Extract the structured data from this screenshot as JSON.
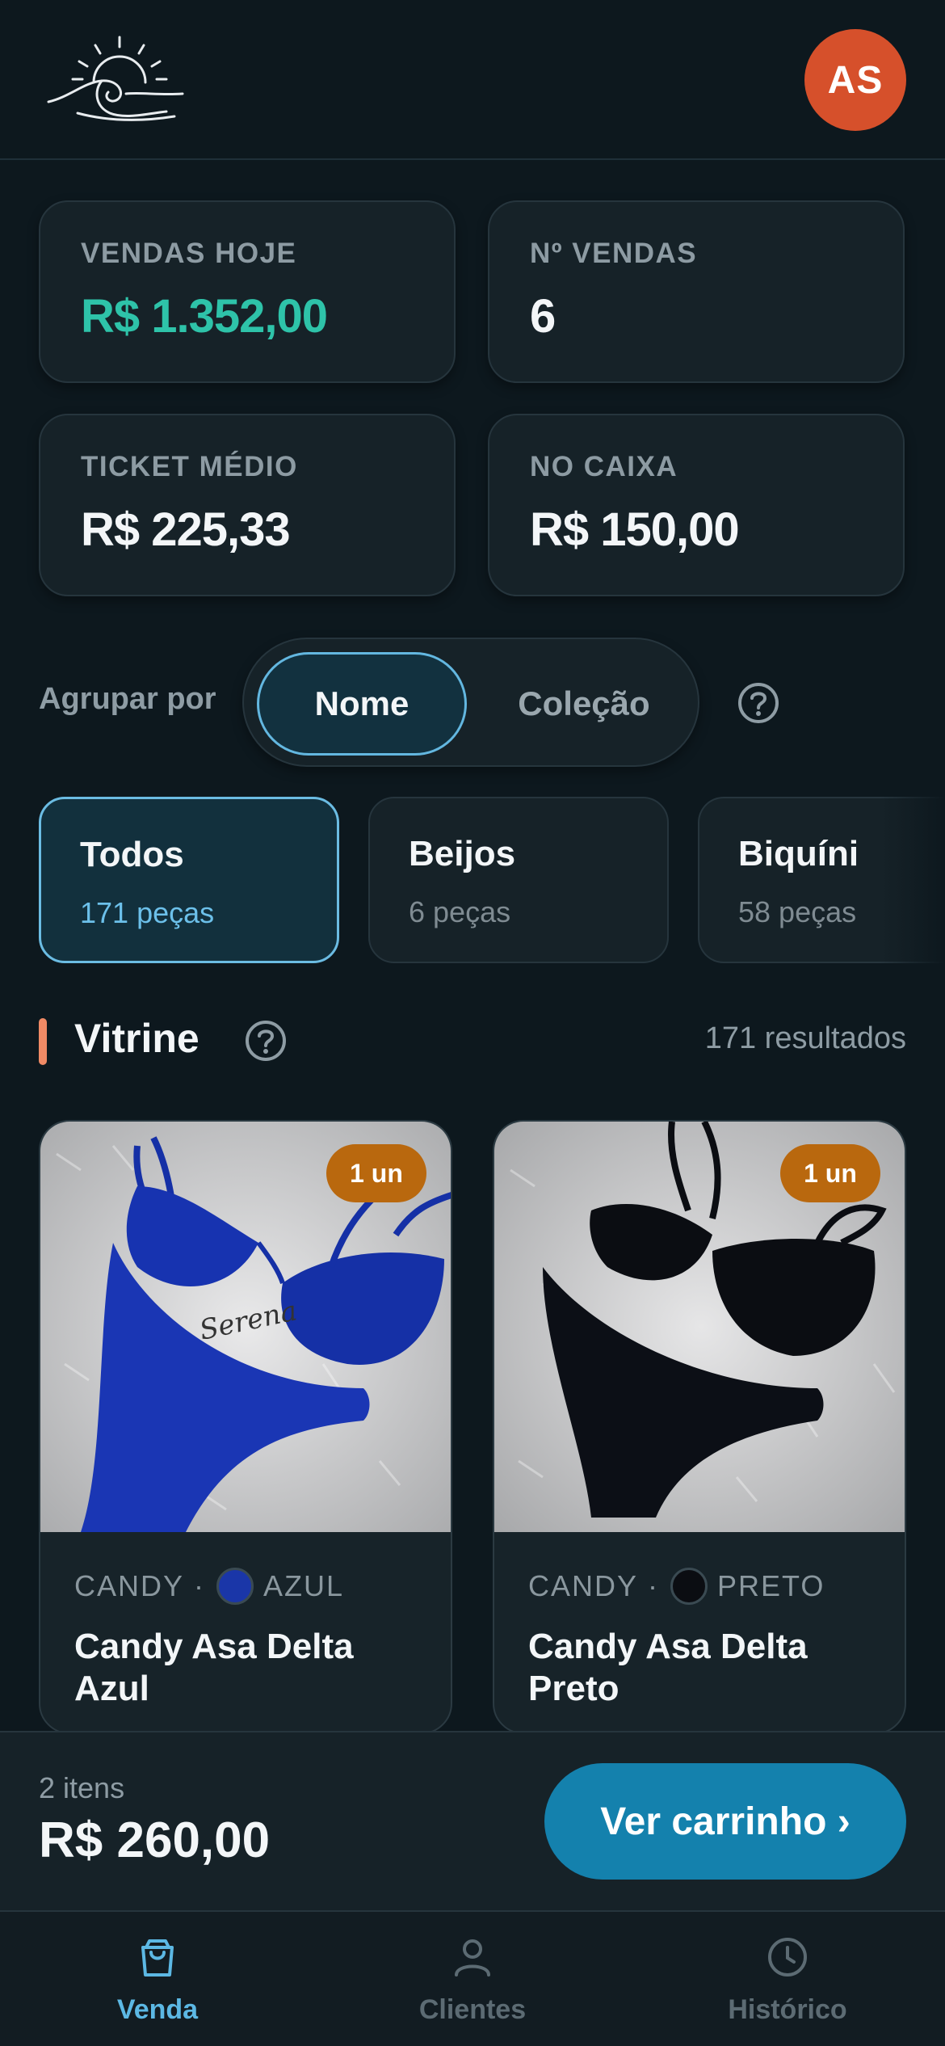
{
  "header": {
    "avatar_initials": "AS"
  },
  "stats": [
    {
      "label": "VENDAS HOJE",
      "value": "R$ 1.352,00",
      "accent": "#2ec3a9"
    },
    {
      "label": "Nº VENDAS",
      "value": "6"
    },
    {
      "label": "TICKET MÉDIO",
      "value": "R$ 225,33"
    },
    {
      "label": "NO CAIXA",
      "value": "R$ 150,00"
    }
  ],
  "group": {
    "label": "Agrupar por",
    "options": [
      "Nome",
      "Coleção"
    ],
    "selected": "Nome"
  },
  "chips": [
    {
      "name": "Todos",
      "count": "171 peças",
      "active": true
    },
    {
      "name": "Beijos",
      "count": "6 peças"
    },
    {
      "name": "Biquíni",
      "count": "58 peças"
    }
  ],
  "section": {
    "title": "Vitrine",
    "results": "171 resultados"
  },
  "products": [
    {
      "badge": "1 un",
      "collection": "CANDY",
      "separator": "·",
      "color_name": "AZUL",
      "color_hex": "#1a36a8",
      "title": "Candy Asa Delta Azul"
    },
    {
      "badge": "1 un",
      "collection": "CANDY",
      "separator": "·",
      "color_name": "PRETO",
      "color_hex": "#0b0d12",
      "title": "Candy Asa Delta Preto"
    }
  ],
  "cart": {
    "items": "2 itens",
    "total": "R$ 260,00",
    "button": "Ver carrinho ›"
  },
  "nav": [
    {
      "label": "Venda",
      "icon": "bag-icon",
      "active": true
    },
    {
      "label": "Clientes",
      "icon": "user-icon"
    },
    {
      "label": "Histórico",
      "icon": "clock-icon"
    }
  ],
  "colors": {
    "background": "#0d181e",
    "accent_blue": "#5cb8e4",
    "accent_orange": "#f08a65",
    "button": "#1481ad",
    "avatar": "#d6502b"
  }
}
